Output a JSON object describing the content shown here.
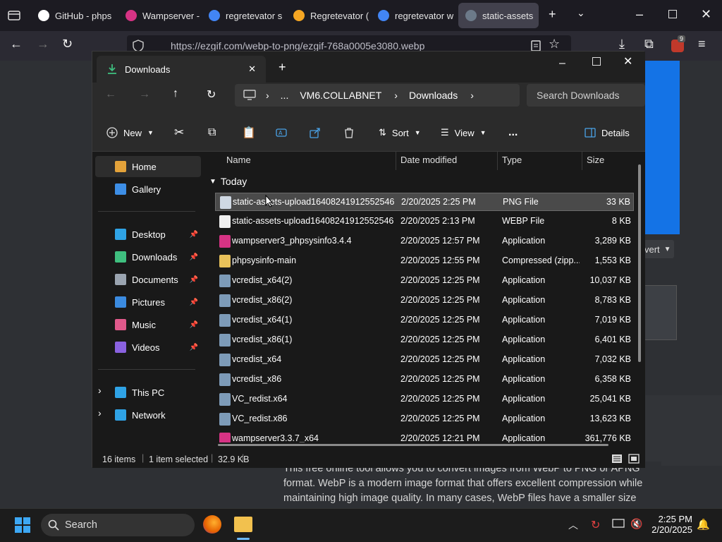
{
  "browser": {
    "tabs": [
      {
        "label": "GitHub - phps",
        "color": "#ffffff"
      },
      {
        "label": "Wampserver -",
        "color": "#d63384"
      },
      {
        "label": "regretevator s",
        "color": "#4285f4"
      },
      {
        "label": "Regretevator (",
        "color": "#f5a623"
      },
      {
        "label": "regretevator w",
        "color": "#4285f4"
      },
      {
        "label": "static-assets",
        "color": "#6c7a89"
      }
    ],
    "url": "https://ezgif.com/webp-to-png/ezgif-768a0005e3080.webp",
    "extension_badge": "9"
  },
  "webpage": {
    "convert_label": "vert",
    "body_text": "This free online tool allows you to convert images from WebP to PNG or APNG format. WebP is a modern image format that offers excellent compression while maintaining high image quality. In many cases, WebP files have a smaller size compared to PNG, making them more efficient for web use. However, WebP is not universally supported"
  },
  "explorer": {
    "tab_title": "Downloads",
    "address": {
      "computer": "VM6.COLLABNET",
      "folder": "Downloads",
      "more": "..."
    },
    "search_placeholder": "Search Downloads",
    "commands": {
      "new": "New",
      "sort": "Sort",
      "view": "View",
      "details": "Details",
      "more": "..."
    },
    "sidebar": [
      {
        "label": "Home",
        "icon": "home-icon",
        "color": "#e3a23a",
        "pinned": false,
        "selected": true
      },
      {
        "label": "Gallery",
        "icon": "gallery-icon",
        "color": "#3d8ee6",
        "pinned": false
      },
      {
        "label": "Desktop",
        "icon": "desktop-icon",
        "color": "#2fa3e6",
        "pinned": true
      },
      {
        "label": "Downloads",
        "icon": "download-icon",
        "color": "#3fbf7f",
        "pinned": true
      },
      {
        "label": "Documents",
        "icon": "document-icon",
        "color": "#9aa4b0",
        "pinned": true
      },
      {
        "label": "Pictures",
        "icon": "pictures-icon",
        "color": "#3b8be0",
        "pinned": true
      },
      {
        "label": "Music",
        "icon": "music-icon",
        "color": "#e0598b",
        "pinned": true
      },
      {
        "label": "Videos",
        "icon": "videos-icon",
        "color": "#8a62e0",
        "pinned": true
      },
      {
        "label": "This PC",
        "icon": "pc-icon",
        "color": "#2fa3e6",
        "pinned": false
      },
      {
        "label": "Network",
        "icon": "network-icon",
        "color": "#2fa3e6",
        "pinned": false
      }
    ],
    "columns": {
      "name": "Name",
      "date": "Date modified",
      "type": "Type",
      "size": "Size"
    },
    "group_label": "Today",
    "files": [
      {
        "name": "static-assets-upload164082419125525467...",
        "date": "2/20/2025 2:25 PM",
        "type": "PNG File",
        "size": "33 KB",
        "icon": "png-file-icon",
        "color": "#cfd8e3",
        "selected": true
      },
      {
        "name": "static-assets-upload164082419125525467...",
        "date": "2/20/2025 2:13 PM",
        "type": "WEBP File",
        "size": "8 KB",
        "icon": "file-icon",
        "color": "#f0f0f0"
      },
      {
        "name": "wampserver3_phpsysinfo3.4.4",
        "date": "2/20/2025 12:57 PM",
        "type": "Application",
        "size": "3,289 KB",
        "icon": "wamp-icon",
        "color": "#d63384"
      },
      {
        "name": "phpsysinfo-main",
        "date": "2/20/2025 12:55 PM",
        "type": "Compressed (zipp...",
        "size": "1,553 KB",
        "icon": "zip-folder-icon",
        "color": "#e8c15a"
      },
      {
        "name": "vcredist_x64(2)",
        "date": "2/20/2025 12:25 PM",
        "type": "Application",
        "size": "10,037 KB",
        "icon": "installer-icon",
        "color": "#7d9bb8"
      },
      {
        "name": "vcredist_x86(2)",
        "date": "2/20/2025 12:25 PM",
        "type": "Application",
        "size": "8,783 KB",
        "icon": "installer-icon",
        "color": "#7d9bb8"
      },
      {
        "name": "vcredist_x64(1)",
        "date": "2/20/2025 12:25 PM",
        "type": "Application",
        "size": "7,019 KB",
        "icon": "installer-icon",
        "color": "#7d9bb8"
      },
      {
        "name": "vcredist_x86(1)",
        "date": "2/20/2025 12:25 PM",
        "type": "Application",
        "size": "6,401 KB",
        "icon": "installer-icon",
        "color": "#7d9bb8"
      },
      {
        "name": "vcredist_x64",
        "date": "2/20/2025 12:25 PM",
        "type": "Application",
        "size": "7,032 KB",
        "icon": "installer-icon",
        "color": "#7d9bb8"
      },
      {
        "name": "vcredist_x86",
        "date": "2/20/2025 12:25 PM",
        "type": "Application",
        "size": "6,358 KB",
        "icon": "installer-icon",
        "color": "#7d9bb8"
      },
      {
        "name": "VC_redist.x64",
        "date": "2/20/2025 12:25 PM",
        "type": "Application",
        "size": "25,041 KB",
        "icon": "installer-icon",
        "color": "#7d9bb8"
      },
      {
        "name": "VC_redist.x86",
        "date": "2/20/2025 12:25 PM",
        "type": "Application",
        "size": "13,623 KB",
        "icon": "installer-icon",
        "color": "#7d9bb8"
      },
      {
        "name": "wampserver3.3.7_x64",
        "date": "2/20/2025 12:21 PM",
        "type": "Application",
        "size": "361,776 KB",
        "icon": "wamp-icon",
        "color": "#d63384"
      }
    ],
    "status": {
      "items": "16 items",
      "selected": "1 item selected",
      "size": "32.9 KB"
    }
  },
  "taskbar": {
    "search_label": "Search",
    "time": "2:25 PM",
    "date": "2/20/2025"
  }
}
